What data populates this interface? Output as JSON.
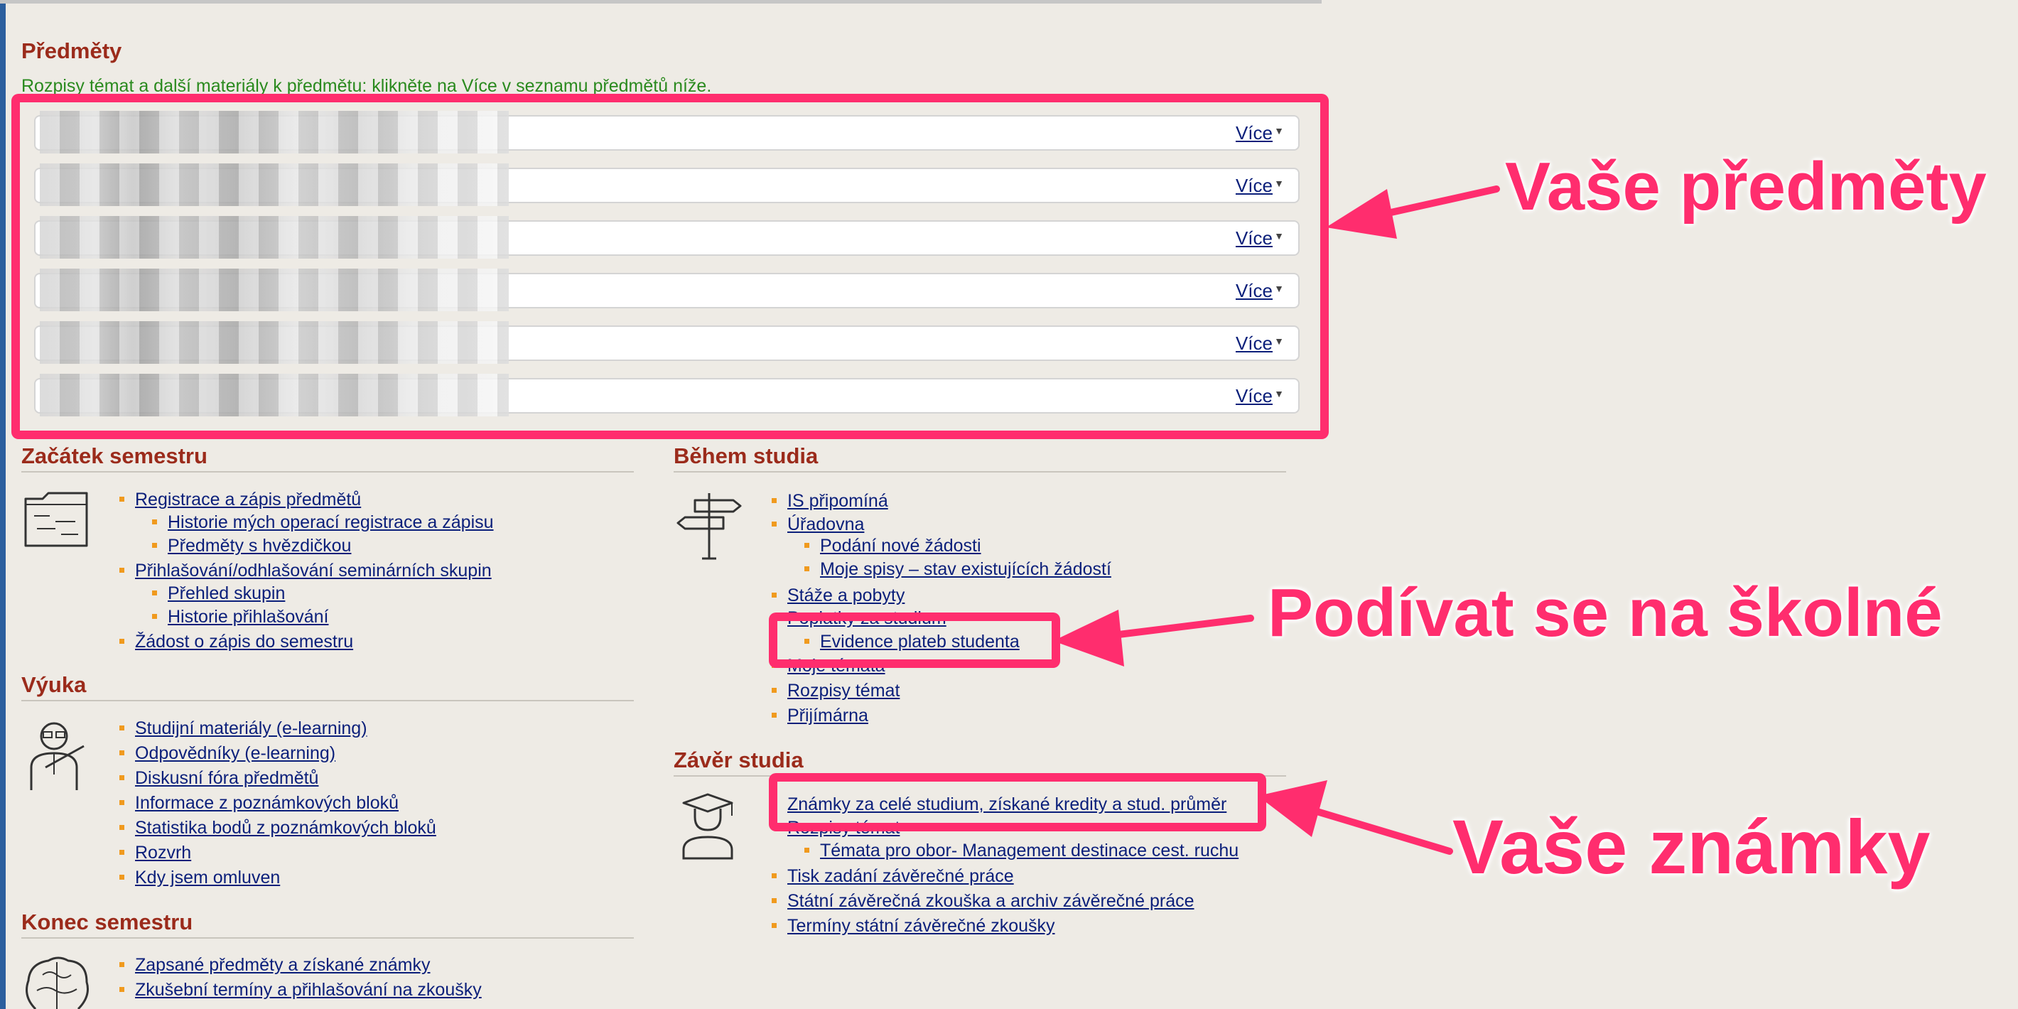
{
  "subjects": {
    "title": "Předměty",
    "subtitle": "Rozpisy témat a další materiály k předmětu: klikněte na Více v seznamu předmětů níže.",
    "more_label": "Více"
  },
  "sections": {
    "start": {
      "title": "Začátek semestru",
      "items": [
        "Registrace a zápis předmětů",
        "Historie mých operací registrace a zápisu",
        "Předměty s hvězdičkou",
        "Přihlašování/odhlašování seminárních skupin",
        "Přehled skupin",
        "Historie přihlašování",
        "Žádost o zápis do semestru"
      ]
    },
    "teaching": {
      "title": "Výuka",
      "items": [
        "Studijní materiály (e-learning)",
        "Odpovědníky (e-learning)",
        "Diskusní fóra předmětů",
        "Informace z poznámkových bloků",
        "Statistika bodů z poznámkových bloků",
        "Rozvrh",
        "Kdy jsem omluven"
      ]
    },
    "end": {
      "title": "Konec semestru",
      "items": [
        "Zapsané předměty a získané známky",
        "Zkušební termíny a přihlašování na zkoušky"
      ]
    },
    "during": {
      "title": "Během studia",
      "items": [
        "IS připomíná",
        "Úřadovna",
        "Podání nové žádosti",
        "Moje spisy – stav existujících žádostí",
        "Stáže a pobyty",
        "Poplatky za studium",
        "Evidence plateb studenta",
        "Moje témata",
        "Rozpisy témat",
        "Přijímárna"
      ]
    },
    "final": {
      "title": "Závěr studia",
      "items": [
        "Známky za celé studium, získané kredity a stud. průměr",
        "Rozpisy témat",
        "Témata pro obor- Management destinace cest. ruchu",
        "Tisk zadání závěrečné práce",
        "Státní závěrečná zkouška a archiv závěrečné práce",
        "Termíny státní závěrečné zkoušky"
      ]
    }
  },
  "annotations": {
    "courses": "Vaše předměty",
    "fees": "Podívat se na školné",
    "grades": "Vaše známky"
  },
  "colors": {
    "background": "#eeebe5",
    "section_title": "#9b2b1b",
    "subtitle": "#2a8a1e",
    "link": "#0b1f7a",
    "bullet": "#f09a1e",
    "annotation": "#ff2d6e",
    "left_bar": "#2c5f9e"
  },
  "icons": {
    "start": "folder-icon",
    "teaching": "teacher-icon",
    "end": "brain-icon",
    "during": "signpost-icon",
    "final": "graduate-icon"
  }
}
